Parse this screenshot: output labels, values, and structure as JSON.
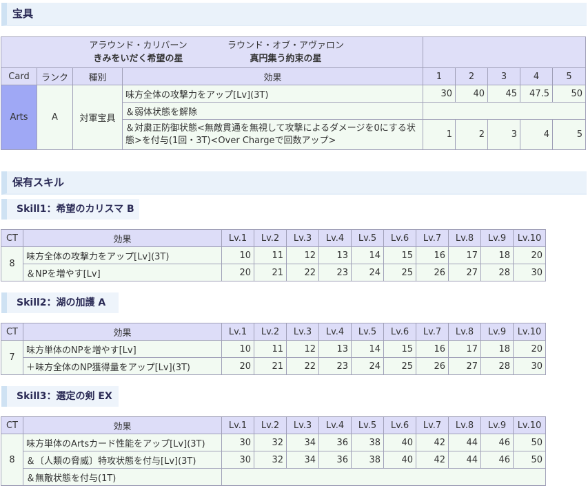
{
  "noble": {
    "heading": "宝具",
    "name1": "アラウンド・カリバーン",
    "ruby1": "きみをいだく希望の星",
    "name2": "ラウンド・オブ・アヴァロン",
    "ruby2": "真円集う約束の星",
    "headers": {
      "card": "Card",
      "rank": "ランク",
      "type": "種別",
      "effect": "効果",
      "l1": "1",
      "l2": "2",
      "l3": "3",
      "l4": "4",
      "l5": "5"
    },
    "card": "Arts",
    "rank": "A",
    "type": "対軍宝具",
    "rows": [
      {
        "effect": "味方全体の攻撃力をアップ[Lv](3T)",
        "values": [
          "30",
          "40",
          "45",
          "47.5",
          "50"
        ]
      },
      {
        "effect": "＆弱体状態を解除",
        "values": []
      },
      {
        "effect": "＆対粛正防御状態<無敵貫通を無視して攻撃によるダメージを0にする状態>を付与(1回・3T)<Over Chargeで回数アップ>",
        "values": [
          "1",
          "2",
          "3",
          "4",
          "5"
        ]
      }
    ]
  },
  "skills_heading": "保有スキル",
  "skill_headers": {
    "ct": "CT",
    "effect": "効果",
    "levels": [
      "Lv.1",
      "Lv.2",
      "Lv.3",
      "Lv.4",
      "Lv.5",
      "Lv.6",
      "Lv.7",
      "Lv.8",
      "Lv.9",
      "Lv.10"
    ]
  },
  "skill1": {
    "title": "Skill1：希望のカリスマ B",
    "ct": "8",
    "rows": [
      {
        "effect": "味方全体の攻撃力をアップ[Lv](3T)",
        "values": [
          "10",
          "11",
          "12",
          "13",
          "14",
          "15",
          "16",
          "17",
          "18",
          "20"
        ]
      },
      {
        "effect": "＆NPを増やす[Lv]",
        "values": [
          "20",
          "21",
          "22",
          "23",
          "24",
          "25",
          "26",
          "27",
          "28",
          "30"
        ]
      }
    ]
  },
  "skill2": {
    "title": "Skill2：湖の加護 A",
    "ct": "7",
    "rows": [
      {
        "effect": "味方単体のNPを増やす[Lv]",
        "values": [
          "10",
          "11",
          "12",
          "13",
          "14",
          "15",
          "16",
          "17",
          "18",
          "20"
        ]
      },
      {
        "effect": "＋味方全体のNP獲得量をアップ[Lv](3T)",
        "values": [
          "20",
          "21",
          "22",
          "23",
          "24",
          "25",
          "26",
          "27",
          "28",
          "30"
        ]
      }
    ]
  },
  "skill3": {
    "title": "Skill3：選定の剣 EX",
    "ct": "8",
    "rows": [
      {
        "effect": "味方単体のArtsカード性能をアップ[Lv](3T)",
        "values": [
          "30",
          "32",
          "34",
          "36",
          "38",
          "40",
          "42",
          "44",
          "46",
          "50"
        ]
      },
      {
        "effect": "＆〔人類の脅威〕特攻状態を付与[Lv](3T)",
        "values": [
          "30",
          "32",
          "34",
          "36",
          "38",
          "40",
          "42",
          "44",
          "46",
          "50"
        ]
      },
      {
        "effect": "＆無敵状態を付与(1T)",
        "values": []
      }
    ]
  }
}
